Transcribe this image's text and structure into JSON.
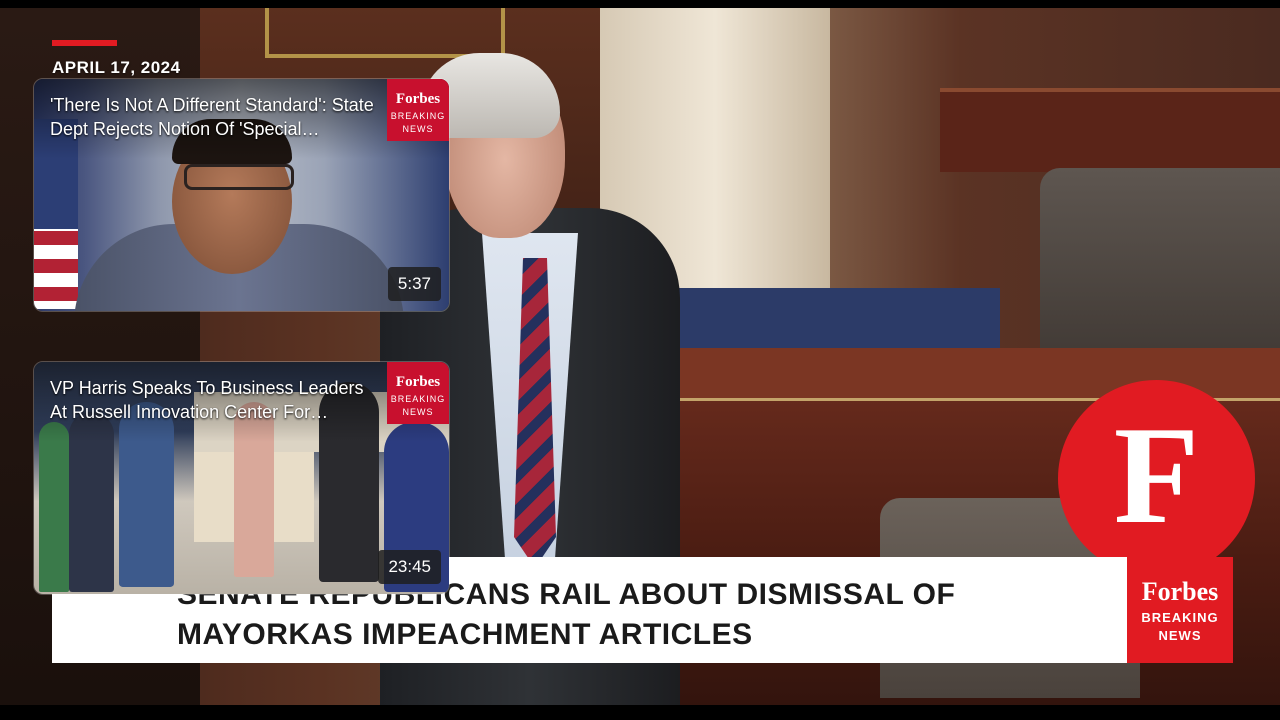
{
  "video": {
    "date": "APRIL 17, 2024",
    "headline_line1": "SENATE REPUBLICANS RAIL ABOUT DISMISSAL OF",
    "headline_line2": "MAYORKAS IMPEACHMENT ARTICLES",
    "logo_letter": "F",
    "brand": "Forbes",
    "brand_sub_line1": "BREAKING",
    "brand_sub_line2": "NEWS"
  },
  "suggestions": [
    {
      "title_line1": "'There Is Not A Different Standard': State",
      "title_line2": "Dept Rejects Notion Of 'Special…",
      "duration": "5:37",
      "badge_brand": "Forbes",
      "badge_line1": "BREAKING",
      "badge_line2": "NEWS"
    },
    {
      "title_line1": "VP Harris Speaks To Business Leaders",
      "title_line2": "At Russell Innovation Center For…",
      "duration": "23:45",
      "badge_brand": "Forbes",
      "badge_line1": "BREAKING",
      "badge_line2": "NEWS"
    }
  ],
  "colors": {
    "brand_red": "#e11b22"
  },
  "icons": {
    "thumb1": "person-thumbnail",
    "thumb2": "group-thumbnail"
  }
}
